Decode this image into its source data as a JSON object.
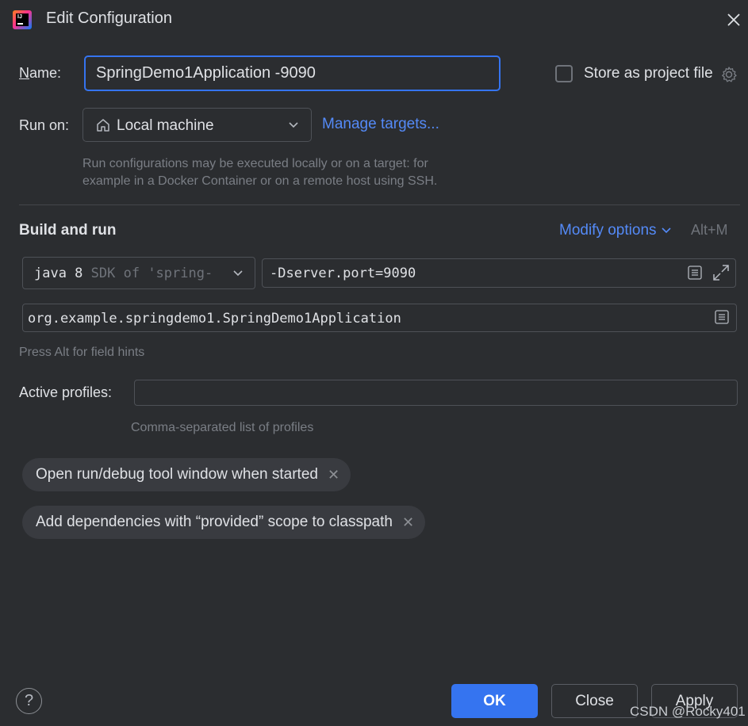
{
  "window": {
    "title": "Edit Configuration",
    "app_icon_text": "IJ"
  },
  "name": {
    "label": "Name:",
    "label_mnemonic": "N",
    "label_rest": "ame:",
    "value": "SpringDemo1Application -9090"
  },
  "store": {
    "label": "Store as project file",
    "checked": false
  },
  "run_on": {
    "label": "Run on:",
    "target": "Local machine",
    "manage_link": "Manage targets...",
    "hint_line1": "Run configurations may be executed locally or on a target: for",
    "hint_line2": "example in a Docker Container or on a remote host using SSH."
  },
  "build_run": {
    "heading": "Build and run",
    "modify_options": "Modify options",
    "shortcut": "Alt+M",
    "sdk_main": "java 8",
    "sdk_sub": "SDK of 'spring-",
    "vm_options": "-Dserver.port=9090",
    "main_class": "org.example.springdemo1.SpringDemo1Application",
    "field_hint": "Press Alt for field hints"
  },
  "profiles": {
    "label": "Active profiles:",
    "value": "",
    "hint": "Comma-separated list of profiles"
  },
  "chips": [
    {
      "label": "Open run/debug tool window when started"
    },
    {
      "label": "Add dependencies with “provided” scope to classpath"
    }
  ],
  "buttons": {
    "ok": "OK",
    "close": "Close",
    "apply": "Apply",
    "help": "?"
  },
  "watermark": "CSDN @Rocky401",
  "colors": {
    "accent": "#3574f0",
    "link": "#548af7",
    "background": "#2b2d30"
  }
}
